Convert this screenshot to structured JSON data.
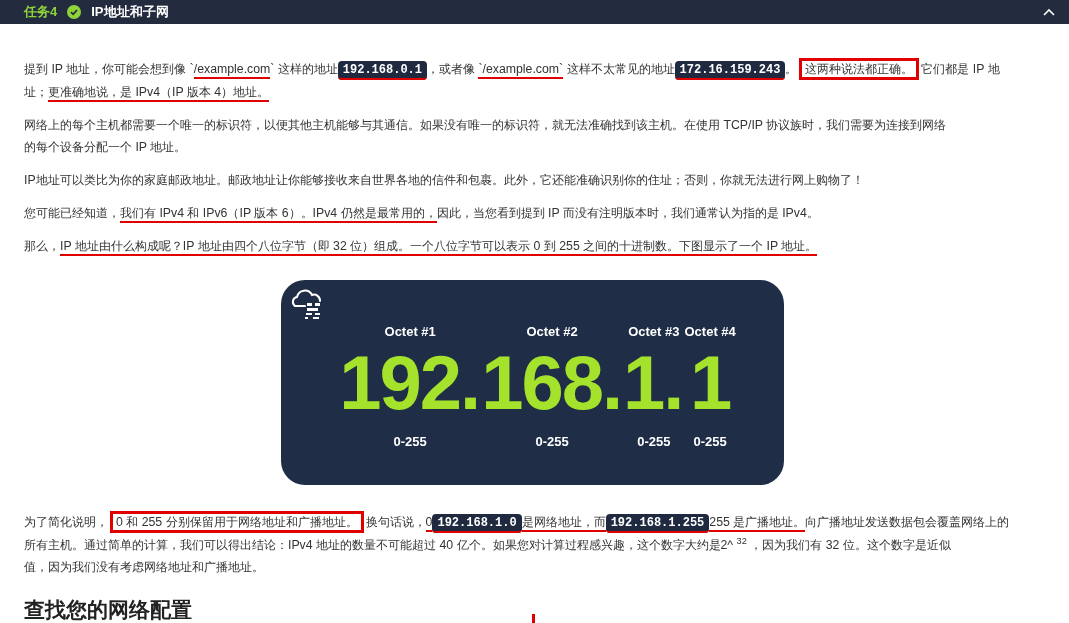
{
  "header": {
    "task": "任务4",
    "done": true,
    "title": "IP地址和子网",
    "expanded": true
  },
  "paragraphs": [
    {
      "lines": [
        [
          {
            "kind": "text",
            "text": "提到 IP 地址，你可能会想到像 `",
            "underlined": false,
            "boxed": false
          },
          {
            "kind": "text",
            "text": "/example.com",
            "underlined": true,
            "boxed": false
          },
          {
            "kind": "text",
            "text": "` 这样的地址",
            "underlined": false,
            "boxed": false
          },
          {
            "kind": "code",
            "text": "192.168.0.1",
            "underlined": true,
            "boxed": false
          },
          {
            "kind": "text",
            "text": "，或者像 ",
            "underlined": false,
            "boxed": false
          },
          {
            "kind": "text",
            "text": "`/example.com`",
            "underlined": true,
            "boxed": false
          },
          {
            "kind": "text",
            "text": " 这样不太常见的地址",
            "underlined": false,
            "boxed": false
          },
          {
            "kind": "code",
            "text": "172.16.159.243",
            "underlined": true,
            "boxed": false
          },
          {
            "kind": "text",
            "text": "。",
            "underlined": false,
            "boxed": false
          },
          {
            "kind": "text",
            "text": "这两种说法都正确。",
            "underlined": false,
            "boxed": true
          },
          {
            "kind": "text",
            "text": "它们都是 IP 地",
            "underlined": false,
            "boxed": false
          }
        ],
        [
          {
            "kind": "text",
            "text": "址；",
            "underlined": false,
            "boxed": false
          },
          {
            "kind": "text",
            "text": "更准确地说，是 IPv4（IP 版本 4）地址。",
            "underlined": true,
            "boxed": false
          }
        ]
      ]
    },
    {
      "lines": [
        [
          {
            "kind": "text",
            "text": "网络上的每个主机都需要一个唯一的标识符，以便其他主机能够与其通信。如果没有唯一的标识符，就无法准确找到该主机。在使用 TCP/IP 协议族时，我们需要为连接到网络",
            "underlined": false,
            "boxed": false
          }
        ],
        [
          {
            "kind": "text",
            "text": "的每个设备分配一个 IP 地址。",
            "underlined": false,
            "boxed": false
          }
        ]
      ]
    },
    {
      "lines": [
        [
          {
            "kind": "text",
            "text": "IP地址可以类比为你的家庭邮政地址。邮政地址让你能够接收来自世界各地的信件和包裹。此外，它还能准确识别你的住址；否则，你就无法进行网上购物了！",
            "underlined": false,
            "boxed": false
          }
        ]
      ]
    },
    {
      "lines": [
        [
          {
            "kind": "text",
            "text": "您可能已经知道，",
            "underlined": false,
            "boxed": false
          },
          {
            "kind": "text",
            "text": "我们有 IPv4 和 IPv6（IP 版本 6）。IPv4 仍然是最常用的，",
            "underlined": true,
            "boxed": false
          },
          {
            "kind": "text",
            "text": "因此，当您看到提到 IP 而没有注明版本时，我们通常认为指的是 IPv4。",
            "underlined": false,
            "boxed": false
          }
        ]
      ]
    },
    {
      "lines": [
        [
          {
            "kind": "text",
            "text": "那么，",
            "underlined": false,
            "boxed": false
          },
          {
            "kind": "text",
            "text": "IP 地址由什么构成呢？IP 地址由四个八位字节（即 32 位）组成。一个八位字节可以表示 0 到 255 之间的十进制数。下图显示了一个 IP 地址。",
            "underlined": true,
            "boxed": false
          }
        ]
      ]
    }
  ],
  "diagram": {
    "separator": ".",
    "octets": [
      {
        "label": "Octet #1",
        "value": "192",
        "range": "0-255"
      },
      {
        "label": "Octet #2",
        "value": "168",
        "range": "0-255"
      },
      {
        "label": "Octet #3",
        "value": "1",
        "range": "0-255"
      },
      {
        "label": "Octet #4",
        "value": "1",
        "range": "0-255"
      }
    ]
  },
  "paragraphs_after": [
    {
      "lines": [
        [
          {
            "kind": "text",
            "text": "为了简化说明，",
            "underlined": false,
            "boxed": false
          },
          {
            "kind": "text",
            "text": "0 和 255 分别保留用于网络地址和广播地址。",
            "underlined": false,
            "boxed": true
          },
          {
            "kind": "text",
            "text": "换句话说，",
            "underlined": false,
            "boxed": false
          },
          {
            "kind": "text",
            "text": "0",
            "underlined": true,
            "boxed": false
          },
          {
            "kind": "code",
            "text": "192.168.1.0",
            "underlined": true,
            "boxed": false
          },
          {
            "kind": "text",
            "text": "是网络地址，而",
            "underlined": true,
            "boxed": false
          },
          {
            "kind": "code",
            "text": "192.168.1.255",
            "underlined": true,
            "boxed": false
          },
          {
            "kind": "text",
            "text": "255 是广播地址。",
            "underlined": true,
            "boxed": false
          },
          {
            "kind": "text",
            "text": "向广播地址发送数据包会覆盖网络上的",
            "underlined": false,
            "boxed": false
          }
        ],
        [
          {
            "kind": "text",
            "text": "所有主机。通过简单的计算，我们可以得出结论：IPv4 地址的数量不可能超过 40 亿个。如果您对计算过程感兴趣，这个数字大约是2^ $^{32}$ ，因为我们有 32 位。这个数字是近似",
            "underlined": false,
            "boxed": false
          }
        ],
        [
          {
            "kind": "text",
            "text": "值，因为我们没有考虑网络地址和广播地址。",
            "underlined": false,
            "boxed": false
          }
        ]
      ]
    }
  ],
  "next_heading": "查找您的网络配置"
}
